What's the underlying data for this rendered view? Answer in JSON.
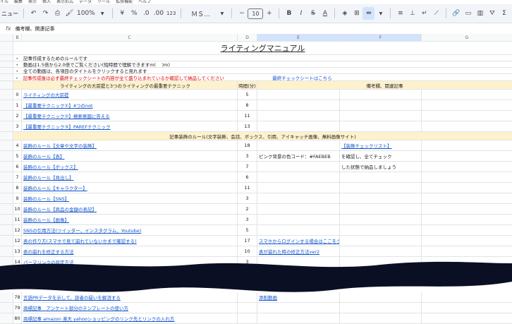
{
  "menu": [
    "イル",
    "編集",
    "表示",
    "挿入",
    "表示形式",
    "データ",
    "ツール",
    "拡張機能",
    "ヘルプ"
  ],
  "toolbar": {
    "left_label": "ニュー",
    "zoom": "100%",
    "currency": "¥",
    "percent": "%",
    "dec_dec": ".0",
    "dec_inc": ".00",
    "numfmt": "123",
    "font": "ＭＳ...",
    "font_size": "10",
    "minus": "−",
    "plus": "+",
    "bold": "B",
    "italic": "I",
    "strike": "S",
    "textcolor": "A"
  },
  "formula_bar": {
    "cell_ref": "fx",
    "content": "備考欄、関連記事"
  },
  "columns": [
    "B",
    "C",
    "D",
    "E",
    "F",
    "G"
  ],
  "title": "ライティングマニュアル",
  "intro": [
    "記事作成するためのルールです",
    "動画は1.5倍から2.0倍でご覧ください(短時間で理解できますm(_ _)m)",
    "全ての動画は、各項目のタイトルをクリックすると見れます",
    "記事作成後は必ず最終チェックシートの内容が全て盛り込まれているか確認して納品してください"
  ],
  "final_check_link": "最終チェックシートはこちら",
  "header_row": {
    "col_c": "ライティングの大前提と3つのライティングの最重要テクニック",
    "col_d": "時間(分)",
    "col_ef": "備考欄、関連記事"
  },
  "rows_a": [
    {
      "num": "0",
      "title": "ライティングの大前提",
      "time": "5"
    },
    {
      "num": "1",
      "title": "【最重要テクニック①】4つのnot",
      "time": "8"
    },
    {
      "num": "2",
      "title": "【最重要テクニック②】検索意図に答える",
      "time": "11"
    },
    {
      "num": "3",
      "title": "【最重要テクニック③】PAREFテクニック",
      "time": "13"
    }
  ],
  "section2": "記事装飾のルール(文字装飾、会話、ボックス、引用、アイキャッチ画像、無料画像サイト)",
  "rows_b": [
    {
      "num": "4",
      "title": "装飾のルール【文章や文字の装飾】",
      "time": "18",
      "e": "",
      "f": "【装飾チェックリスト】"
    },
    {
      "num": "5",
      "title": "装飾のルール【表】",
      "time": "3",
      "e": "ピンク背景の色コード：#FAEBEB",
      "f": "を確認し、全てチェック"
    },
    {
      "num": "6",
      "title": "装飾のルール【ボックス】",
      "time": "7",
      "e": "",
      "f": "した状態で納品しましょう"
    },
    {
      "num": "7",
      "title": "装飾のルール【見出し】",
      "time": "6",
      "e": "",
      "f": ""
    },
    {
      "num": "8",
      "title": "装飾のルール【キャラクター】",
      "time": "11",
      "e": "",
      "f": ""
    },
    {
      "num": "9",
      "title": "装飾のルール【SNS】",
      "time": "3",
      "e": "",
      "f": ""
    },
    {
      "num": "10",
      "title": "装飾のルール【商品の金額の表記】",
      "time": "2",
      "e": "",
      "f": ""
    },
    {
      "num": "11",
      "title": "装飾のルール【画像】",
      "time": "3",
      "e": "",
      "f": ""
    },
    {
      "num": "12",
      "title": "SNSの引用方法(ツイッター、インスタグラム、Youtube)",
      "time": "5",
      "e": "",
      "f": ""
    },
    {
      "num": "12",
      "title": "表の作り方(スマホで見て崩れていないかまで確認する)",
      "time": "17",
      "e": "スマホからログインする場合はここをクリック",
      "f": ""
    },
    {
      "num": "13",
      "title": "表の崩れを修正する方法",
      "time": "10",
      "e": "表が崩れた時の修正方法ver2",
      "f": ""
    },
    {
      "num": "14",
      "title": "パーマリンクの設定方法",
      "time": "3",
      "e": "",
      "f": ""
    }
  ],
  "rows_c": [
    {
      "num": "78",
      "title": "言語PRデータを示して、読者の疑いを解消する",
      "time": "",
      "e": "添削動画",
      "f": ""
    },
    {
      "num": "79",
      "title": "商標記事　アンケート部分のテンプレートの使い方",
      "time": "",
      "e": "",
      "f": ""
    },
    {
      "num": "80",
      "title": "商標記事 amazon 楽天 yahooショッピングのリンク先とリンクの入れ方",
      "time": "",
      "e": "",
      "f": ""
    }
  ],
  "colors": {
    "header_yellow": "#fef2cc",
    "link": "#1155cc",
    "red_text": "#e00000",
    "wave": "#0b0f24"
  }
}
